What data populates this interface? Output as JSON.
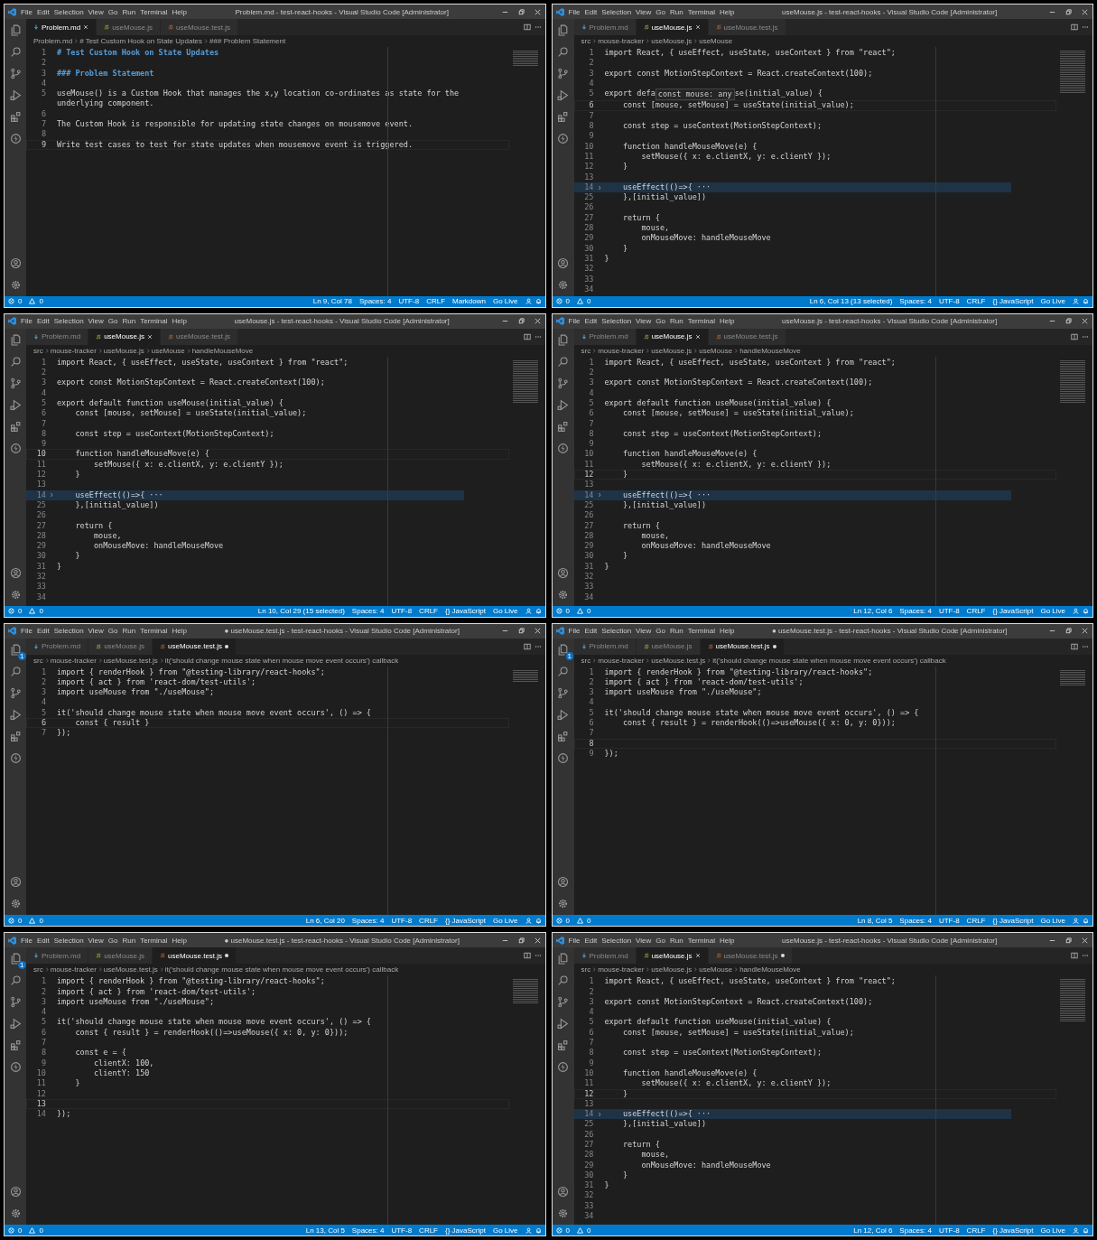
{
  "panels": [
    {
      "title": "Problem.md - test-react-hooks - Visual Studio Code [Administrator]",
      "menu": [
        "File",
        "Edit",
        "Selection",
        "View",
        "Go",
        "Run",
        "Terminal",
        "Help"
      ],
      "tabs": [
        {
          "label": "Problem.md",
          "kind": "md",
          "selected": true,
          "modified": false
        },
        {
          "label": "useMouse.js",
          "kind": "js",
          "selected": false,
          "modified": false
        },
        {
          "label": "useMouse.test.js",
          "kind": "js",
          "selected": false,
          "modified": false
        }
      ],
      "breadcrumb": [
        "Problem.md",
        "# Test Custom Hook on State Updates",
        "### Problem Statement"
      ],
      "lines": [
        {
          "number": "1",
          "text": "# Test Custom Hook on State Updates",
          "kind": "heading",
          "current": false
        },
        {
          "number": "2",
          "kind": "code",
          "current": false
        },
        {
          "number": "3",
          "text": "### Problem Statement",
          "kind": "heading",
          "current": false
        },
        {
          "number": "4",
          "kind": "code",
          "current": false
        },
        {
          "number": "5",
          "text": "useMouse() is a Custom Hook that manages the x,y location co-ordinates as state for the underlying component.",
          "kind": "code",
          "current": false
        },
        {
          "number": "6",
          "kind": "code",
          "current": false
        },
        {
          "number": "7",
          "text": "The Custom Hook is responsible for updating state changes on mousemove event.",
          "kind": "code",
          "current": false
        },
        {
          "number": "8",
          "kind": "code",
          "current": false
        },
        {
          "number": "9",
          "text": "Write test cases to test for state updates when mousemove event is triggered.",
          "kind": "code",
          "current": true
        }
      ],
      "status": {
        "errors": "0",
        "warnings": "0",
        "items": [
          "Ln 9, Col 78",
          "Spaces: 4",
          "UTF-8",
          "CRLF",
          "Markdown",
          "Go Live"
        ]
      }
    },
    {
      "title": "useMouse.js - test-react-hooks - Visual Studio Code [Administrator]",
      "menu": [
        "File",
        "Edit",
        "Selection",
        "View",
        "Go",
        "Run",
        "Terminal",
        "Help"
      ],
      "tabs": [
        {
          "label": "Problem.md",
          "kind": "md",
          "selected": false,
          "modified": false
        },
        {
          "label": "useMouse.js",
          "kind": "js",
          "selected": true,
          "modified": false
        },
        {
          "label": "useMouse.test.js",
          "kind": "js",
          "selected": false,
          "modified": false
        }
      ],
      "breadcrumb": [
        "src",
        "mouse-tracker",
        "useMouse.js",
        "useMouse"
      ],
      "lines": [
        {
          "number": "1",
          "text": "import React, { useEffect, useState, useContext } from \"react\";",
          "kind": "code",
          "current": false
        },
        {
          "number": "2",
          "kind": "code",
          "current": false
        },
        {
          "number": "3",
          "text": "export const MotionStepContext = React.createContext(100);",
          "kind": "code",
          "current": false
        },
        {
          "number": "4",
          "kind": "code",
          "current": false
        },
        {
          "number": "5",
          "text": "export defa",
          "tooltip": "const mouse: any",
          "rest": "se(initial_value) {",
          "kind": "code",
          "current": false
        },
        {
          "number": "6",
          "text": "    const [mouse, setMouse] = useState(initial_value);",
          "kind": "code",
          "current": true
        },
        {
          "number": "7",
          "kind": "code",
          "current": false
        },
        {
          "number": "8",
          "text": "    const step = useContext(MotionStepContext);",
          "kind": "code",
          "current": false
        },
        {
          "number": "9",
          "kind": "code",
          "current": false
        },
        {
          "number": "10",
          "text": "    function handleMouseMove(e) {",
          "kind": "code",
          "current": false
        },
        {
          "number": "11",
          "text": "        setMouse({ x: e.clientX, y: e.clientY });",
          "kind": "code",
          "current": false
        },
        {
          "number": "12",
          "text": "    }",
          "kind": "code",
          "current": false
        },
        {
          "number": "13",
          "kind": "code",
          "current": false
        },
        {
          "number": "14",
          "text": "    useEffect(()=>{ ···",
          "kind": "folded",
          "current": false
        },
        {
          "number": "25",
          "text": "    },[initial_value])",
          "kind": "code",
          "current": false
        },
        {
          "number": "26",
          "kind": "code",
          "current": false
        },
        {
          "number": "27",
          "text": "    return {",
          "kind": "code",
          "current": false
        },
        {
          "number": "28",
          "text": "        mouse,",
          "kind": "code",
          "current": false
        },
        {
          "number": "29",
          "text": "        onMouseMove: handleMouseMove",
          "kind": "code",
          "current": false
        },
        {
          "number": "30",
          "text": "    }",
          "kind": "code",
          "current": false
        },
        {
          "number": "31",
          "text": "}",
          "kind": "code",
          "current": false
        },
        {
          "number": "32",
          "kind": "code",
          "current": false
        },
        {
          "number": "33",
          "kind": "code",
          "current": false
        },
        {
          "number": "34",
          "kind": "code",
          "current": false
        }
      ],
      "status": {
        "errors": "0",
        "warnings": "0",
        "items": [
          "Ln 6, Col 13 (13 selected)",
          "Spaces: 4",
          "UTF-8",
          "CRLF",
          "{} JavaScript",
          "Go Live"
        ]
      }
    },
    {
      "title": "useMouse.js - test-react-hooks - Visual Studio Code [Administrator]",
      "menu": [
        "File",
        "Edit",
        "Selection",
        "View",
        "Go",
        "Run",
        "Terminal",
        "Help"
      ],
      "tabs": [
        {
          "label": "Problem.md",
          "kind": "md",
          "selected": false,
          "modified": false
        },
        {
          "label": "useMouse.js",
          "kind": "js",
          "selected": true,
          "modified": false
        },
        {
          "label": "useMouse.test.js",
          "kind": "js",
          "selected": false,
          "modified": false
        }
      ],
      "breadcrumb": [
        "src",
        "mouse-tracker",
        "useMouse.js",
        "useMouse",
        "handleMouseMove"
      ],
      "lines": [
        {
          "number": "1",
          "text": "import React, { useEffect, useState, useContext } from \"react\";",
          "kind": "code",
          "current": false
        },
        {
          "number": "2",
          "kind": "code",
          "current": false
        },
        {
          "number": "3",
          "text": "export const MotionStepContext = React.createContext(100);",
          "kind": "code",
          "current": false
        },
        {
          "number": "4",
          "kind": "code",
          "current": false
        },
        {
          "number": "5",
          "text": "export default function useMouse(initial_value) {",
          "kind": "code",
          "current": false
        },
        {
          "number": "6",
          "text": "    const [mouse, setMouse] = useState(initial_value);",
          "kind": "code",
          "current": false
        },
        {
          "number": "7",
          "kind": "code",
          "current": false
        },
        {
          "number": "8",
          "text": "    const step = useContext(MotionStepContext);",
          "kind": "code",
          "current": false
        },
        {
          "number": "9",
          "kind": "code",
          "current": false
        },
        {
          "number": "10",
          "text": "    function handleMouseMove(e) {",
          "kind": "code",
          "current": true
        },
        {
          "number": "11",
          "text": "        setMouse({ x: e.clientX, y: e.clientY });",
          "kind": "code",
          "current": false
        },
        {
          "number": "12",
          "text": "    }",
          "kind": "code",
          "current": false
        },
        {
          "number": "13",
          "kind": "code",
          "current": false
        },
        {
          "number": "14",
          "text": "    useEffect(()=>{ ···",
          "kind": "folded",
          "current": false
        },
        {
          "number": "25",
          "text": "    },[initial_value])",
          "kind": "code",
          "current": false
        },
        {
          "number": "26",
          "kind": "code",
          "current": false
        },
        {
          "number": "27",
          "text": "    return {",
          "kind": "code",
          "current": false
        },
        {
          "number": "28",
          "text": "        mouse,",
          "kind": "code",
          "current": false
        },
        {
          "number": "29",
          "text": "        onMouseMove: handleMouseMove",
          "kind": "code",
          "current": false
        },
        {
          "number": "30",
          "text": "    }",
          "kind": "code",
          "current": false
        },
        {
          "number": "31",
          "text": "}",
          "kind": "code",
          "current": false
        },
        {
          "number": "32",
          "kind": "code",
          "current": false
        },
        {
          "number": "33",
          "kind": "code",
          "current": false
        },
        {
          "number": "34",
          "kind": "code",
          "current": false
        }
      ],
      "status": {
        "errors": "0",
        "warnings": "0",
        "items": [
          "Ln 10, Col 29 (15 selected)",
          "Spaces: 4",
          "UTF-8",
          "CRLF",
          "{} JavaScript",
          "Go Live"
        ]
      }
    },
    {
      "title": "useMouse.js - test-react-hooks - Visual Studio Code [Administrator]",
      "menu": [
        "File",
        "Edit",
        "Selection",
        "View",
        "Go",
        "Run",
        "Terminal",
        "Help"
      ],
      "tabs": [
        {
          "label": "Problem.md",
          "kind": "md",
          "selected": false,
          "modified": false
        },
        {
          "label": "useMouse.js",
          "kind": "js",
          "selected": true,
          "modified": false
        },
        {
          "label": "useMouse.test.js",
          "kind": "js",
          "selected": false,
          "modified": false
        }
      ],
      "breadcrumb": [
        "src",
        "mouse-tracker",
        "useMouse.js",
        "useMouse",
        "handleMouseMove"
      ],
      "lines": [
        {
          "number": "1",
          "text": "import React, { useEffect, useState, useContext } from \"react\";",
          "kind": "code",
          "current": false
        },
        {
          "number": "2",
          "kind": "code",
          "current": false
        },
        {
          "number": "3",
          "text": "export const MotionStepContext = React.createContext(100);",
          "kind": "code",
          "current": false
        },
        {
          "number": "4",
          "kind": "code",
          "current": false
        },
        {
          "number": "5",
          "text": "export default function useMouse(initial_value) {",
          "kind": "code",
          "current": false
        },
        {
          "number": "6",
          "text": "    const [mouse, setMouse] = useState(initial_value);",
          "kind": "code",
          "current": false
        },
        {
          "number": "7",
          "kind": "code",
          "current": false
        },
        {
          "number": "8",
          "text": "    const step = useContext(MotionStepContext);",
          "kind": "code",
          "current": false
        },
        {
          "number": "9",
          "kind": "code",
          "current": false
        },
        {
          "number": "10",
          "text": "    function handleMouseMove(e) {",
          "kind": "code",
          "current": false
        },
        {
          "number": "11",
          "text": "        setMouse({ x: e.clientX, y: e.clientY });",
          "kind": "code",
          "current": false
        },
        {
          "number": "12",
          "text": "    }",
          "kind": "code",
          "current": true
        },
        {
          "number": "13",
          "kind": "code",
          "current": false
        },
        {
          "number": "14",
          "text": "    useEffect(()=>{ ···",
          "kind": "folded",
          "current": false
        },
        {
          "number": "25",
          "text": "    },[initial_value])",
          "kind": "code",
          "current": false
        },
        {
          "number": "26",
          "kind": "code",
          "current": false
        },
        {
          "number": "27",
          "text": "    return {",
          "kind": "code",
          "current": false
        },
        {
          "number": "28",
          "text": "        mouse,",
          "kind": "code",
          "current": false
        },
        {
          "number": "29",
          "text": "        onMouseMove: handleMouseMove",
          "kind": "code",
          "current": false
        },
        {
          "number": "30",
          "text": "    }",
          "kind": "code",
          "current": false
        },
        {
          "number": "31",
          "text": "}",
          "kind": "code",
          "current": false
        },
        {
          "number": "32",
          "kind": "code",
          "current": false
        },
        {
          "number": "33",
          "kind": "code",
          "current": false
        },
        {
          "number": "34",
          "kind": "code",
          "current": false
        }
      ],
      "status": {
        "errors": "0",
        "warnings": "0",
        "items": [
          "Ln 12, Col 6",
          "Spaces: 4",
          "UTF-8",
          "CRLF",
          "{} JavaScript",
          "Go Live"
        ]
      }
    },
    {
      "title": "● useMouse.test.js - test-react-hooks - Visual Studio Code [Administrator]",
      "menu": [
        "File",
        "Edit",
        "Selection",
        "View",
        "Go",
        "Run",
        "Terminal",
        "Help"
      ],
      "explorer_badge": "1",
      "tabs": [
        {
          "label": "Problem.md",
          "kind": "md",
          "selected": false,
          "modified": false
        },
        {
          "label": "useMouse.js",
          "kind": "js",
          "selected": false,
          "modified": false
        },
        {
          "label": "useMouse.test.js",
          "kind": "js",
          "selected": true,
          "modified": true
        }
      ],
      "breadcrumb": [
        "src",
        "mouse-tracker",
        "useMouse.test.js",
        "it('should change mouse state when mouse move event occurs') callback"
      ],
      "lines": [
        {
          "number": "1",
          "text": "import { renderHook } from \"@testing-library/react-hooks\";",
          "kind": "code",
          "current": false
        },
        {
          "number": "2",
          "text": "import { act } from 'react-dom/test-utils';",
          "kind": "code",
          "current": false
        },
        {
          "number": "3",
          "text": "import useMouse from \"./useMouse\";",
          "kind": "code",
          "current": false
        },
        {
          "number": "4",
          "kind": "code",
          "current": false
        },
        {
          "number": "5",
          "text": "it('should change mouse state when mouse move event occurs', () => {",
          "kind": "code",
          "current": false
        },
        {
          "number": "6",
          "text": "    const { result }",
          "kind": "code",
          "current": true
        },
        {
          "number": "7",
          "text": "});",
          "kind": "code",
          "current": false
        }
      ],
      "status": {
        "errors": "0",
        "warnings": "0",
        "items": [
          "Ln 6, Col 20",
          "Spaces: 4",
          "UTF-8",
          "CRLF",
          "{} JavaScript",
          "Go Live"
        ]
      }
    },
    {
      "title": "● useMouse.test.js - test-react-hooks - Visual Studio Code [Administrator]",
      "menu": [
        "File",
        "Edit",
        "Selection",
        "View",
        "Go",
        "Run",
        "Terminal",
        "Help"
      ],
      "explorer_badge": "1",
      "tabs": [
        {
          "label": "Problem.md",
          "kind": "md",
          "selected": false,
          "modified": false
        },
        {
          "label": "useMouse.js",
          "kind": "js",
          "selected": false,
          "modified": false
        },
        {
          "label": "useMouse.test.js",
          "kind": "js",
          "selected": true,
          "modified": true
        }
      ],
      "breadcrumb": [
        "src",
        "mouse-tracker",
        "useMouse.test.js",
        "it('should change mouse state when mouse move event occurs') callback"
      ],
      "lines": [
        {
          "number": "1",
          "text": "import { renderHook } from \"@testing-library/react-hooks\";",
          "kind": "code",
          "current": false
        },
        {
          "number": "2",
          "text": "import { act } from 'react-dom/test-utils';",
          "kind": "code",
          "current": false
        },
        {
          "number": "3",
          "text": "import useMouse from \"./useMouse\";",
          "kind": "code",
          "current": false
        },
        {
          "number": "4",
          "kind": "code",
          "current": false
        },
        {
          "number": "5",
          "text": "it('should change mouse state when mouse move event occurs', () => {",
          "kind": "code",
          "current": false
        },
        {
          "number": "6",
          "text": "    const { result } = renderHook(()=>useMouse({ x: 0, y: 0}));",
          "kind": "code",
          "current": false
        },
        {
          "number": "7",
          "kind": "code",
          "current": false
        },
        {
          "number": "8",
          "kind": "code",
          "current": true
        },
        {
          "number": "9",
          "text": "});",
          "kind": "code",
          "current": false
        }
      ],
      "status": {
        "errors": "0",
        "warnings": "0",
        "items": [
          "Ln 8, Col 5",
          "Spaces: 4",
          "UTF-8",
          "CRLF",
          "{} JavaScript",
          "Go Live"
        ]
      }
    },
    {
      "title": "● useMouse.test.js - test-react-hooks - Visual Studio Code [Administrator]",
      "menu": [
        "File",
        "Edit",
        "Selection",
        "View",
        "Go",
        "Run",
        "Terminal",
        "Help"
      ],
      "explorer_badge": "1",
      "tabs": [
        {
          "label": "Problem.md",
          "kind": "md",
          "selected": false,
          "modified": false
        },
        {
          "label": "useMouse.js",
          "kind": "js",
          "selected": false,
          "modified": false
        },
        {
          "label": "useMouse.test.js",
          "kind": "js",
          "selected": true,
          "modified": true
        }
      ],
      "breadcrumb": [
        "src",
        "mouse-tracker",
        "useMouse.test.js",
        "it('should change mouse state when mouse move event occurs') callback"
      ],
      "lines": [
        {
          "number": "1",
          "text": "import { renderHook } from \"@testing-library/react-hooks\";",
          "kind": "code",
          "current": false
        },
        {
          "number": "2",
          "text": "import { act } from 'react-dom/test-utils';",
          "kind": "code",
          "current": false
        },
        {
          "number": "3",
          "text": "import useMouse from \"./useMouse\";",
          "kind": "code",
          "current": false
        },
        {
          "number": "4",
          "kind": "code",
          "current": false
        },
        {
          "number": "5",
          "text": "it('should change mouse state when mouse move event occurs', () => {",
          "kind": "code",
          "current": false
        },
        {
          "number": "6",
          "text": "    const { result } = renderHook(()=>useMouse({ x: 0, y: 0}));",
          "kind": "code",
          "current": false
        },
        {
          "number": "7",
          "kind": "code",
          "current": false
        },
        {
          "number": "8",
          "text": "    const e = {",
          "kind": "code",
          "current": false
        },
        {
          "number": "9",
          "text": "        clientX: 100,",
          "kind": "code",
          "current": false
        },
        {
          "number": "10",
          "text": "        clientY: 150",
          "kind": "code",
          "current": false
        },
        {
          "number": "11",
          "text": "    }",
          "kind": "code",
          "current": false
        },
        {
          "number": "12",
          "kind": "code",
          "current": false
        },
        {
          "number": "13",
          "kind": "code",
          "current": true
        },
        {
          "number": "14",
          "text": "});",
          "kind": "code",
          "current": false
        }
      ],
      "status": {
        "errors": "0",
        "warnings": "0",
        "items": [
          "Ln 13, Col 5",
          "Spaces: 4",
          "UTF-8",
          "CRLF",
          "{} JavaScript",
          "Go Live"
        ]
      }
    },
    {
      "title": "useMouse.js - test-react-hooks - Visual Studio Code [Administrator]",
      "menu": [
        "File",
        "Edit",
        "Selection",
        "View",
        "Go",
        "Run",
        "Terminal",
        "Help"
      ],
      "tabs": [
        {
          "label": "Problem.md",
          "kind": "md",
          "selected": false,
          "modified": false
        },
        {
          "label": "useMouse.js",
          "kind": "js",
          "selected": true,
          "modified": false
        },
        {
          "label": "useMouse.test.js",
          "kind": "js",
          "selected": false,
          "modified": true
        }
      ],
      "breadcrumb": [
        "src",
        "mouse-tracker",
        "useMouse.js",
        "useMouse",
        "handleMouseMove"
      ],
      "lines": [
        {
          "number": "1",
          "text": "import React, { useEffect, useState, useContext } from \"react\";",
          "kind": "code",
          "current": false
        },
        {
          "number": "2",
          "kind": "code",
          "current": false
        },
        {
          "number": "3",
          "text": "export const MotionStepContext = React.createContext(100);",
          "kind": "code",
          "current": false
        },
        {
          "number": "4",
          "kind": "code",
          "current": false
        },
        {
          "number": "5",
          "text": "export default function useMouse(initial_value) {",
          "kind": "code",
          "current": false
        },
        {
          "number": "6",
          "text": "    const [mouse, setMouse] = useState(initial_value);",
          "kind": "code",
          "current": false
        },
        {
          "number": "7",
          "kind": "code",
          "current": false
        },
        {
          "number": "8",
          "text": "    const step = useContext(MotionStepContext);",
          "kind": "code",
          "current": false
        },
        {
          "number": "9",
          "kind": "code",
          "current": false
        },
        {
          "number": "10",
          "text": "    function handleMouseMove(e) {",
          "kind": "code",
          "current": false
        },
        {
          "number": "11",
          "text": "        setMouse({ x: e.clientX, y: e.clientY });",
          "kind": "code",
          "current": false
        },
        {
          "number": "12",
          "text": "    }",
          "kind": "code",
          "current": true
        },
        {
          "number": "13",
          "kind": "code",
          "current": false
        },
        {
          "number": "14",
          "text": "    useEffect(()=>{ ···",
          "kind": "folded",
          "current": false
        },
        {
          "number": "25",
          "text": "    },[initial_value])",
          "kind": "code",
          "current": false
        },
        {
          "number": "26",
          "kind": "code",
          "current": false
        },
        {
          "number": "27",
          "text": "    return {",
          "kind": "code",
          "current": false
        },
        {
          "number": "28",
          "text": "        mouse,",
          "kind": "code",
          "current": false
        },
        {
          "number": "29",
          "text": "        onMouseMove: handleMouseMove",
          "kind": "code",
          "current": false
        },
        {
          "number": "30",
          "text": "    }",
          "kind": "code",
          "current": false
        },
        {
          "number": "31",
          "text": "}",
          "kind": "code",
          "current": false
        },
        {
          "number": "32",
          "kind": "code",
          "current": false
        },
        {
          "number": "33",
          "kind": "code",
          "current": false
        },
        {
          "number": "34",
          "kind": "code",
          "current": false
        }
      ],
      "status": {
        "errors": "0",
        "warnings": "0",
        "items": [
          "Ln 12, Col 6",
          "Spaces: 4",
          "UTF-8",
          "CRLF",
          "{} JavaScript",
          "Go Live"
        ]
      }
    }
  ]
}
